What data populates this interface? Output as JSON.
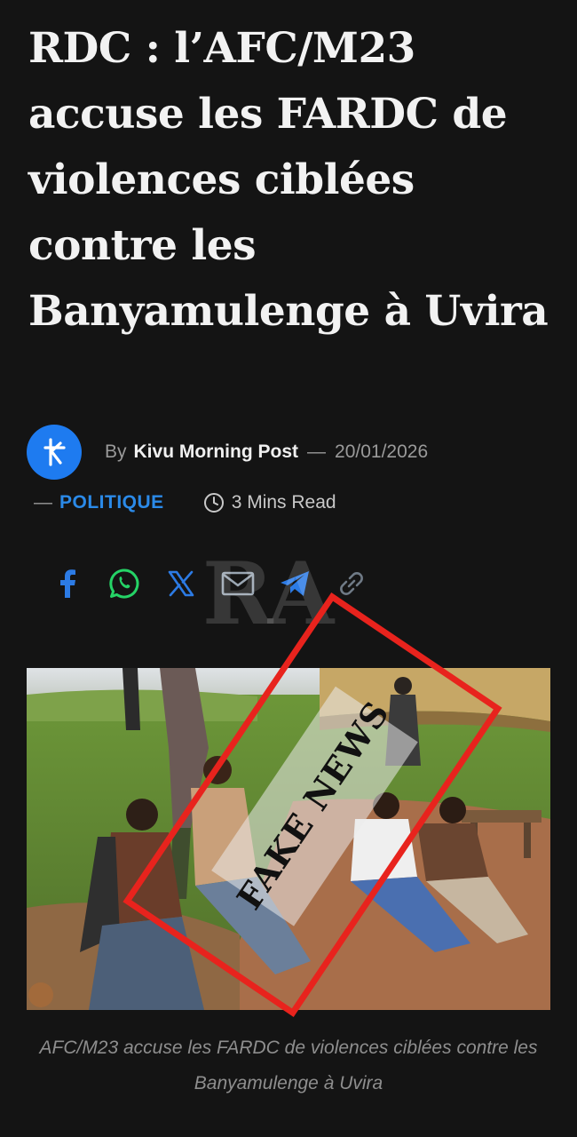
{
  "article": {
    "title": "RDC : l’AFC/M23 accuse les FARDC de violences ciblées contre les Banyamulenge à Uvira"
  },
  "author": {
    "avatar_icon": "kmp-logo-icon",
    "avatar_color": "#1e7bf0",
    "by_prefix": "By",
    "name": "Kivu Morning Post",
    "separator": "—",
    "date": "20/01/2026"
  },
  "meta": {
    "dash": "—",
    "category": "POLITIQUE",
    "category_color": "#2b8ae8",
    "read_time": "3 Mins Read"
  },
  "share": {
    "items": [
      {
        "name": "facebook-icon",
        "color": "#2c7be5"
      },
      {
        "name": "whatsapp-icon",
        "color": "#25d366"
      },
      {
        "name": "x-icon",
        "color": "#2c7be5"
      },
      {
        "name": "email-icon",
        "color": "#2c7be5"
      },
      {
        "name": "telegram-icon",
        "color": "#2c7be5"
      },
      {
        "name": "link-icon",
        "color": "#2c7be5"
      }
    ]
  },
  "watermark": {
    "text": "RA"
  },
  "image": {
    "stamp_text": "FAKE NEWS",
    "stamp_color": "#e8231d",
    "caption": "AFC/M23 accuse les FARDC de violences ciblées contre les Banyamulenge à Uvira"
  }
}
